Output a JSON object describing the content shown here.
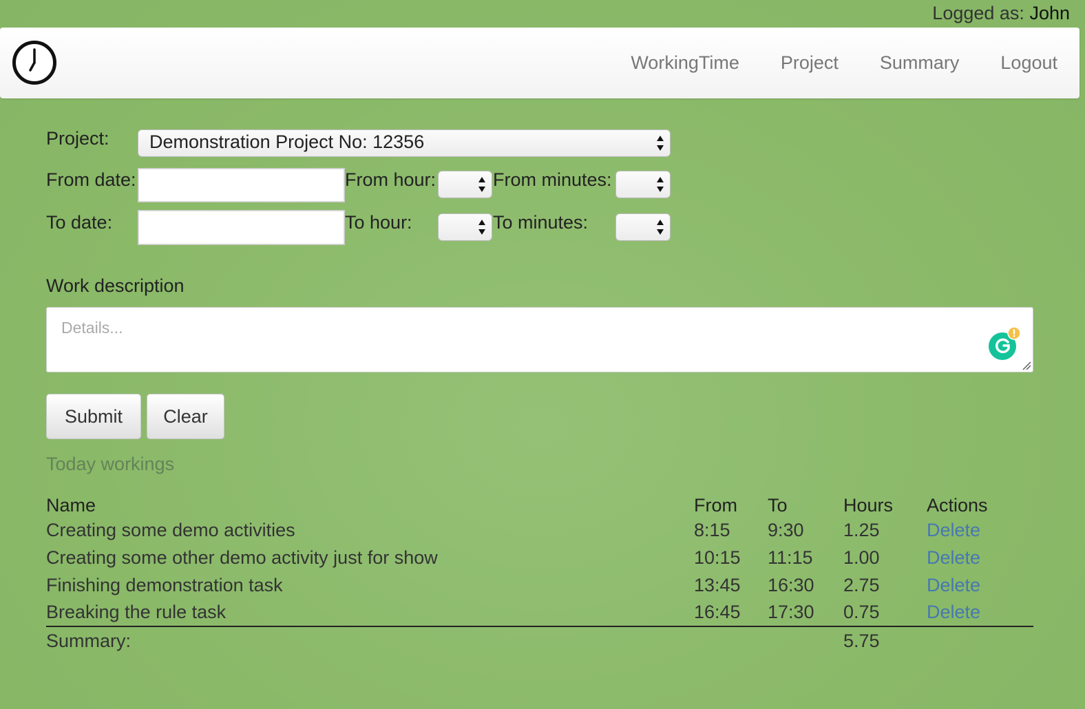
{
  "header": {
    "logged_label": "Logged as:",
    "user_name": "John"
  },
  "nav": {
    "items": [
      "WorkingTime",
      "Project",
      "Summary",
      "Logout"
    ]
  },
  "form": {
    "project_label": "Project:",
    "project_value": "Demonstration Project No: 12356",
    "from_date_label": "From date:",
    "from_hour_label": "From hour:",
    "from_minutes_label": "From minutes:",
    "to_date_label": "To date:",
    "to_hour_label": "To hour:",
    "to_minutes_label": "To minutes:",
    "work_description_label": "Work description",
    "details_placeholder": "Details...",
    "submit_label": "Submit",
    "clear_label": "Clear"
  },
  "today": {
    "title": "Today workings",
    "columns": [
      "Name",
      "From",
      "To",
      "Hours",
      "Actions"
    ],
    "rows": [
      {
        "name": "Creating some demo activities",
        "from": "8:15",
        "to": "9:30",
        "hours": "1.25",
        "action": "Delete"
      },
      {
        "name": "Creating some other demo activity just for show",
        "from": "10:15",
        "to": "11:15",
        "hours": "1.00",
        "action": "Delete"
      },
      {
        "name": "Finishing demonstration task",
        "from": "13:45",
        "to": "16:30",
        "hours": "2.75",
        "action": "Delete"
      },
      {
        "name": "Breaking the rule task",
        "from": "16:45",
        "to": "17:30",
        "hours": "0.75",
        "action": "Delete"
      }
    ],
    "summary_label": "Summary:",
    "summary_hours": "5.75"
  },
  "icons": {
    "logo": "clock-icon",
    "grammarly": "grammarly-icon",
    "grammarly_color": "#15c39a",
    "grammarly_badge_color": "#f5c04a"
  }
}
